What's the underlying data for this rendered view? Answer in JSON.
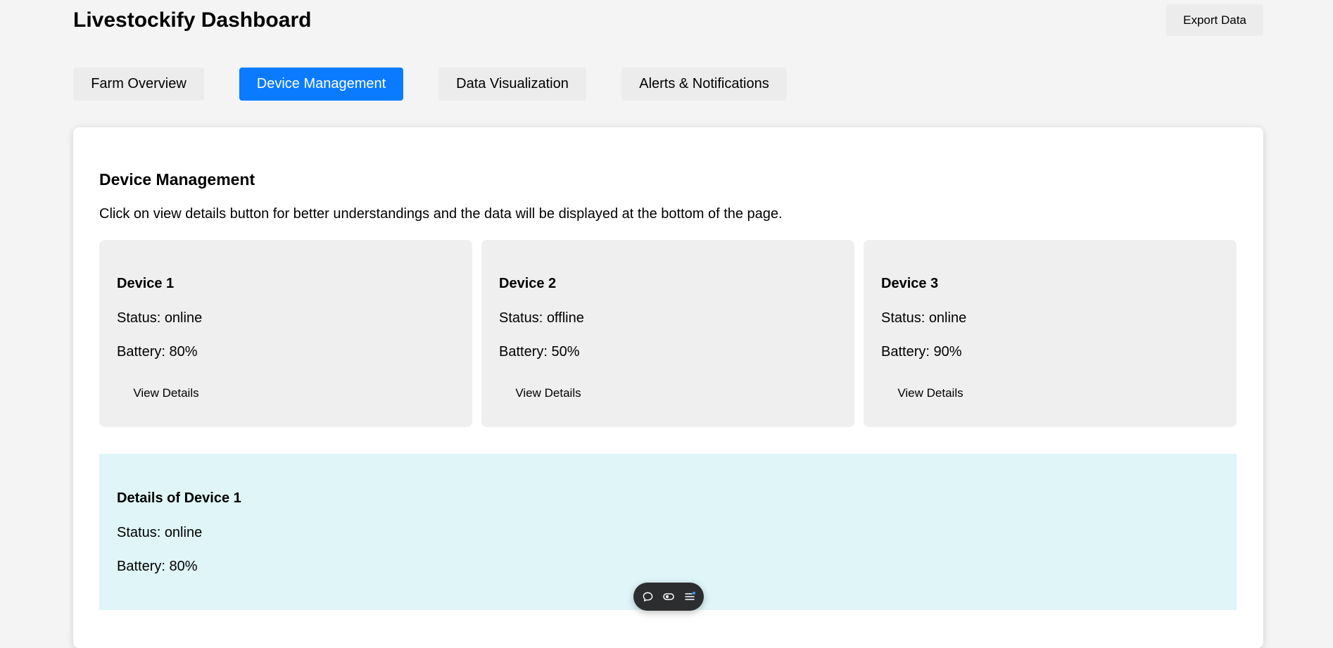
{
  "header": {
    "title": "Livestockify Dashboard",
    "export_label": "Export Data"
  },
  "tabs": [
    {
      "label": "Farm Overview",
      "active": false
    },
    {
      "label": "Device Management",
      "active": true
    },
    {
      "label": "Data Visualization",
      "active": false
    },
    {
      "label": "Alerts & Notifications",
      "active": false
    }
  ],
  "section": {
    "title": "Device Management",
    "description": "Click on view details button for better understandings and the data will be displayed at the bottom of the page."
  },
  "devices": [
    {
      "name": "Device 1",
      "status": "Status: online",
      "battery": "Battery: 80%",
      "button": "View Details"
    },
    {
      "name": "Device 2",
      "status": "Status: offline",
      "battery": "Battery: 50%",
      "button": "View Details"
    },
    {
      "name": "Device 3",
      "status": "Status: online",
      "battery": "Battery: 90%",
      "button": "View Details"
    }
  ],
  "details": {
    "title": "Details of Device 1",
    "status": "Status: online",
    "battery": "Battery: 80%"
  },
  "toolbar": {
    "icons": [
      "chat-icon",
      "toggle-icon",
      "menu-icon"
    ]
  },
  "colors": {
    "accent": "#0a7bff",
    "details_bg": "#dff5f8",
    "toolbar_bg": "#2b2d2f"
  }
}
